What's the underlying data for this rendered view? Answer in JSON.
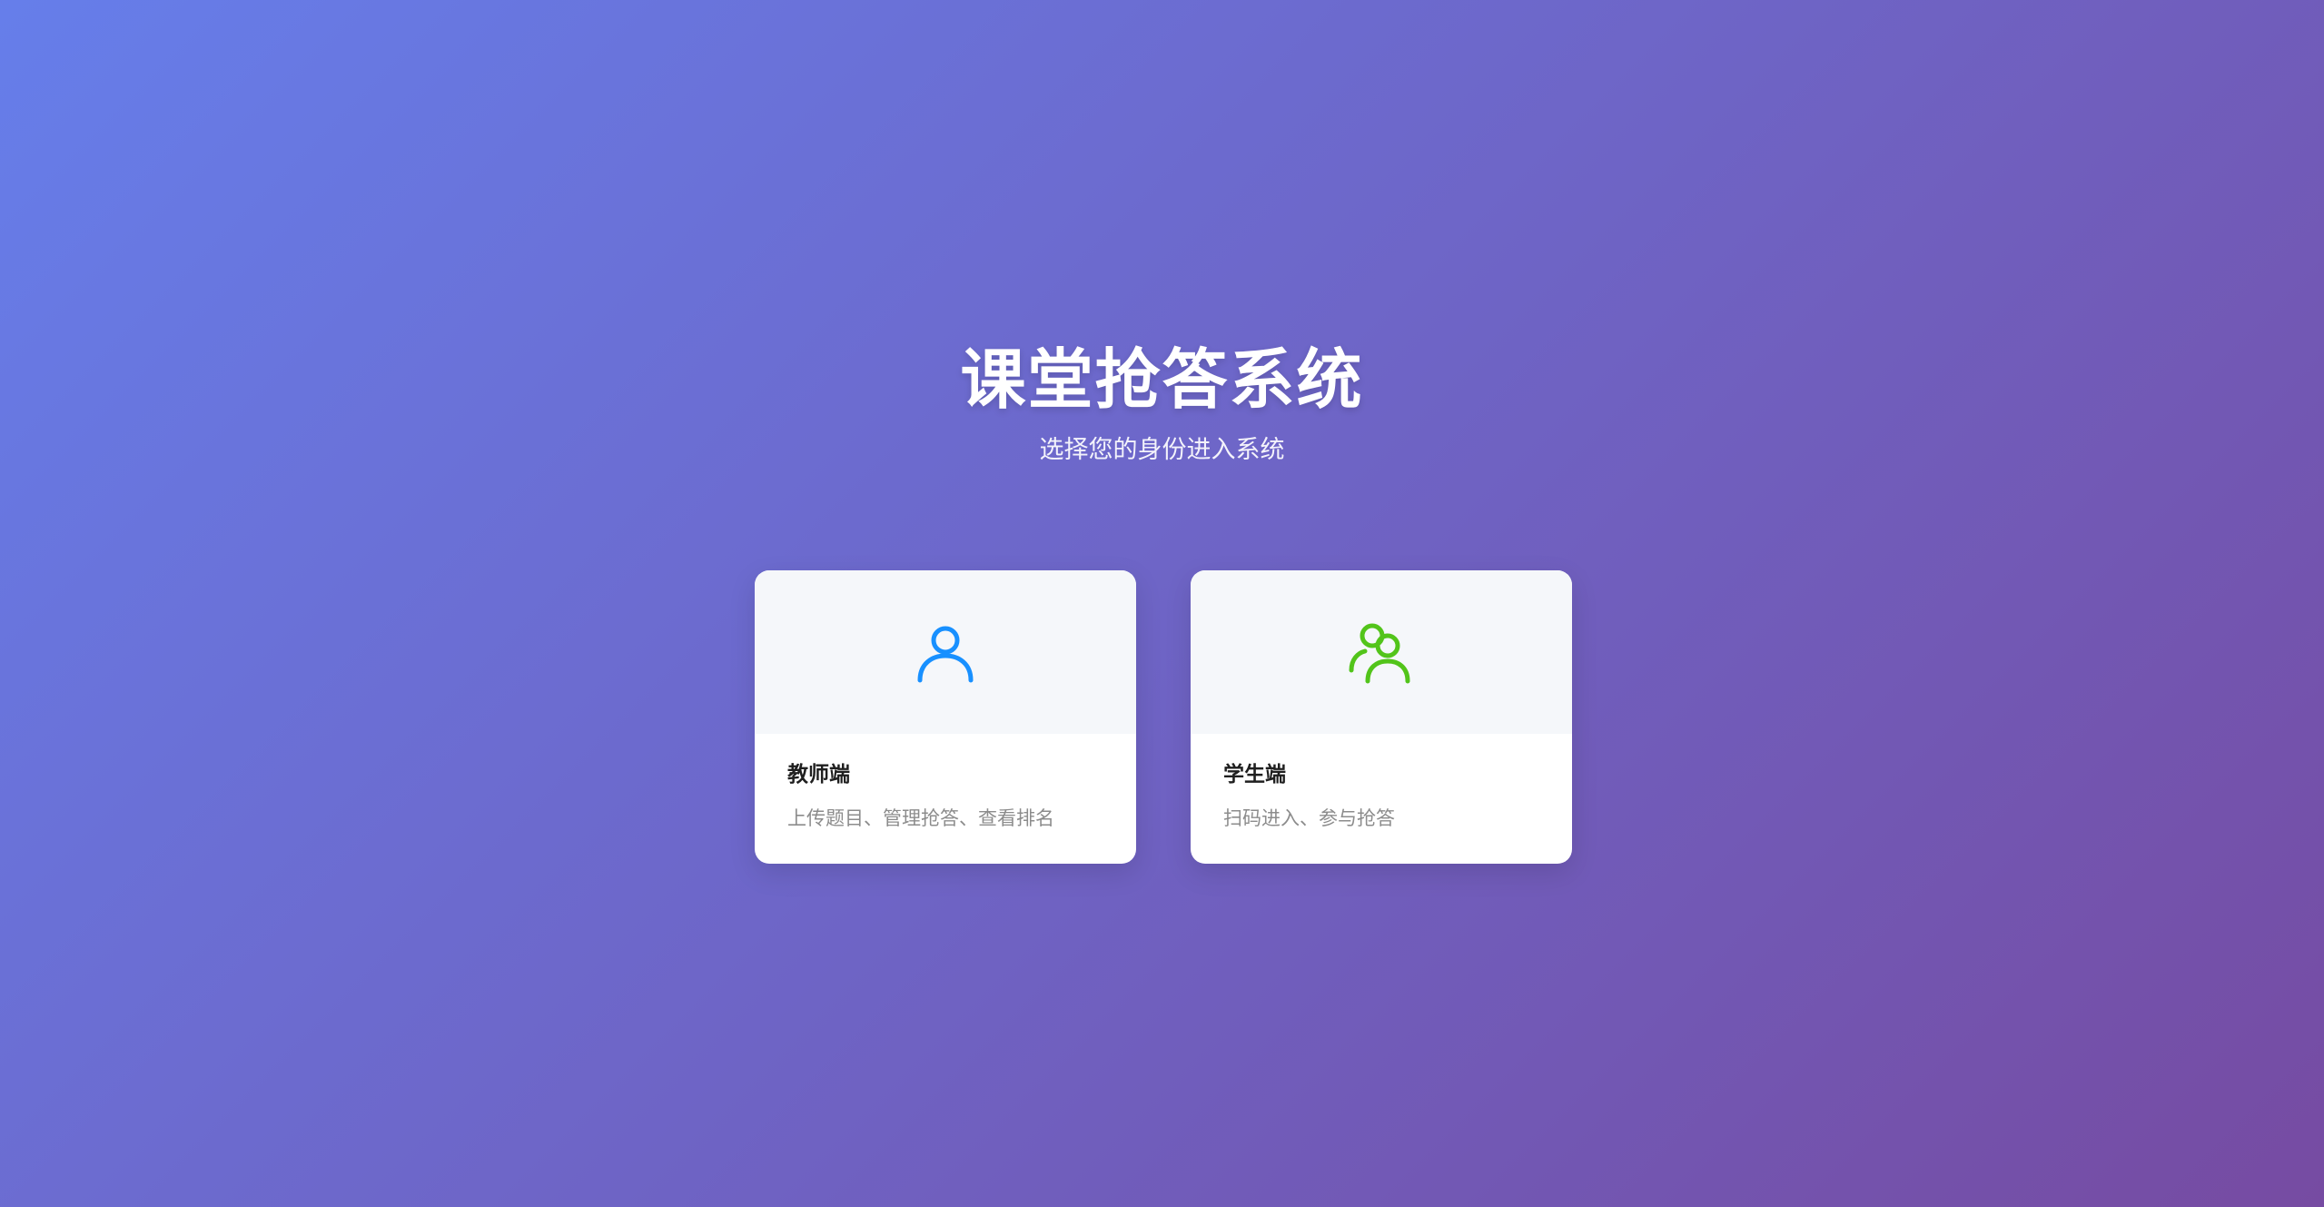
{
  "header": {
    "title": "课堂抢答系统",
    "subtitle": "选择您的身份进入系统"
  },
  "cards": [
    {
      "title": "教师端",
      "description": "上传题目、管理抢答、查看排名",
      "icon": "user-icon",
      "icon_color": "#1890ff"
    },
    {
      "title": "学生端",
      "description": "扫码进入、参与抢答",
      "icon": "team-icon",
      "icon_color": "#52c41a"
    }
  ],
  "colors": {
    "background_start": "#667eea",
    "background_end": "#764ba2",
    "card_top": "#f5f7fa"
  }
}
